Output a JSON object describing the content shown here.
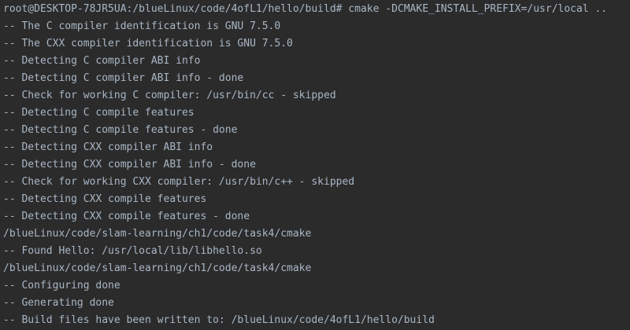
{
  "terminal": {
    "colors": {
      "background": "#2b2b2b",
      "text": "#a9b7c6"
    },
    "lines": [
      "root@DESKTOP-78JR5UA:/blueLinux/code/4ofL1/hello/build# cmake -DCMAKE_INSTALL_PREFIX=/usr/local ..",
      "-- The C compiler identification is GNU 7.5.0",
      "-- The CXX compiler identification is GNU 7.5.0",
      "-- Detecting C compiler ABI info",
      "-- Detecting C compiler ABI info - done",
      "-- Check for working C compiler: /usr/bin/cc - skipped",
      "-- Detecting C compile features",
      "-- Detecting C compile features - done",
      "-- Detecting CXX compiler ABI info",
      "-- Detecting CXX compiler ABI info - done",
      "-- Check for working CXX compiler: /usr/bin/c++ - skipped",
      "-- Detecting CXX compile features",
      "-- Detecting CXX compile features - done",
      "/blueLinux/code/slam-learning/ch1/code/task4/cmake",
      "-- Found Hello: /usr/local/lib/libhello.so",
      "/blueLinux/code/slam-learning/ch1/code/task4/cmake",
      "-- Configuring done",
      "-- Generating done",
      "-- Build files have been written to: /blueLinux/code/4ofL1/hello/build"
    ]
  }
}
